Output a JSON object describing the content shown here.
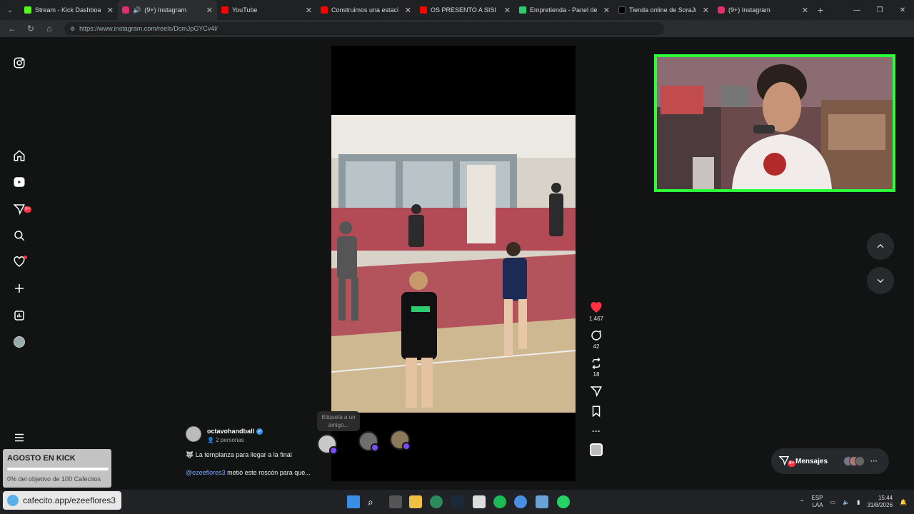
{
  "tabs": [
    {
      "title": "Stream - Kick Dashboard",
      "color": "#53fc18"
    },
    {
      "title": "(9+) Instagram",
      "color": "#e1306c",
      "active": true
    },
    {
      "title": "YouTube",
      "color": "#ff0000"
    },
    {
      "title": "Construimos una estación re",
      "color": "#ff0000"
    },
    {
      "title": "OS PRESENTO A SISI 🐱 LA F",
      "color": "#ff0000"
    },
    {
      "title": "Empretienda - Panel de adm",
      "color": "#2ecc71"
    },
    {
      "title": "Tienda online de SoraJuegos",
      "color": "#111111"
    },
    {
      "title": "(9+) Instagram",
      "color": "#e1306c"
    }
  ],
  "address": {
    "url": "https://www.instagram.com/reels/DcmJpGYCv4l/"
  },
  "sidebar": {
    "messages_badge": "9+"
  },
  "reel": {
    "username": "octavohandball",
    "people": "2 personas",
    "caption": "🐺 La templanza para llegar a la final",
    "mention": "@ezeeflores3",
    "mention_rest": " metió este roscón para que...",
    "tag_tip": "Etiqueta a un amigo..."
  },
  "actions": {
    "likes": "1.467",
    "comments": "42",
    "reposts": "18"
  },
  "messages": {
    "label": "Mensajes",
    "badge": "9+"
  },
  "kick_goal": {
    "title": "AGOSTO EN KICK",
    "subtitle": "0% del objetivo de 100 Cafecitos",
    "progress": 0
  },
  "cafecito": {
    "label": "cafecito.app/ezeeflores3"
  },
  "taskbar": {
    "lang1": "ESP",
    "lang2": "LAA",
    "time": "15:44",
    "date": "31/8/2026"
  }
}
